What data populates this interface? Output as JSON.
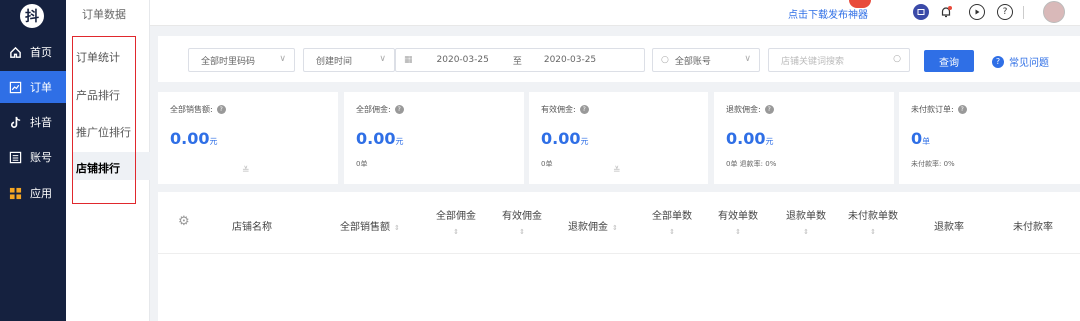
{
  "leftnav": {
    "logo": "抖",
    "items": [
      {
        "label": "首页",
        "icon": "home-icon"
      },
      {
        "label": "订单",
        "icon": "chart-icon"
      },
      {
        "label": "抖音",
        "icon": "tiktok-icon"
      },
      {
        "label": "账号",
        "icon": "list-icon"
      },
      {
        "label": "应用",
        "icon": "apps-icon"
      }
    ]
  },
  "subnav": {
    "header": "订单数据",
    "items": [
      {
        "label": "订单统计"
      },
      {
        "label": "产品排行"
      },
      {
        "label": "推广位排行"
      },
      {
        "label": "店铺排行"
      }
    ]
  },
  "topbar": {
    "promo": "点击下载发布神器",
    "badge_color": "#e84b3c"
  },
  "filters": {
    "pid_select": "全部时里码码",
    "time_type": "创建时间",
    "date_from": "2020-03-25",
    "date_sep": "至",
    "date_to": "2020-03-25",
    "account_select": "全部账号",
    "shop_search_placeholder": "店铺关键词搜索",
    "query_button": "查询",
    "faq_link": "常见问题"
  },
  "cards": [
    {
      "title": "全部销售额:",
      "value": "0.00",
      "unit": "元",
      "sub": ""
    },
    {
      "title": "全部佣金:",
      "value": "0.00",
      "unit": "元",
      "sub": "0单"
    },
    {
      "title": "有效佣金:",
      "value": "0.00",
      "unit": "元",
      "sub": "0单"
    },
    {
      "title": "退款佣金:",
      "value": "0.00",
      "unit": "元",
      "sub": "0单  退款率: 0%"
    },
    {
      "title": "未付款订单:",
      "value": "0",
      "unit": "单",
      "sub": "未付款率: 0%"
    }
  ],
  "table": {
    "columns": [
      "店铺名称",
      "全部销售额",
      "全部佣金",
      "有效佣金",
      "退款佣金",
      "全部单数",
      "有效单数",
      "退款单数",
      "未付款单数",
      "退款率",
      "未付款率"
    ]
  },
  "colors": {
    "accent": "#2f6fe6",
    "nav_bg": "#15213f",
    "highlight_border": "#e0282d"
  }
}
